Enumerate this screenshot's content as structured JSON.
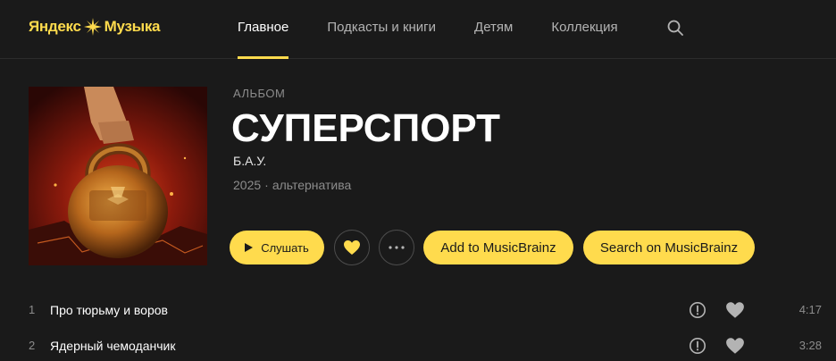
{
  "header": {
    "logo_yandex": "Яндекс",
    "logo_music": "Музыка",
    "nav": [
      {
        "label": "Главное",
        "active": true
      },
      {
        "label": "Подкасты и книги",
        "active": false
      },
      {
        "label": "Детям",
        "active": false
      },
      {
        "label": "Коллекция",
        "active": false
      }
    ],
    "search_icon": "search-icon"
  },
  "album": {
    "kind": "АЛЬБОМ",
    "title": "СУПЕРСПОРТ",
    "artist": "Б.А.У.",
    "year": "2025",
    "separator": "·",
    "genre": "альтернатива"
  },
  "actions": {
    "play_label": "Слушать",
    "like_icon": "heart-icon",
    "more_icon": "more-icon",
    "add_label": "Add to MusicBrainz",
    "search_label": "Search on MusicBrainz"
  },
  "tracks": [
    {
      "num": "1",
      "title": "Про тюрьму и воров",
      "duration": "4:17"
    },
    {
      "num": "2",
      "title": "Ядерный чемоданчик",
      "duration": "3:28"
    }
  ],
  "colors": {
    "accent": "#ffdb4d",
    "background": "#1a1a1a",
    "muted": "#8c8c8c"
  }
}
